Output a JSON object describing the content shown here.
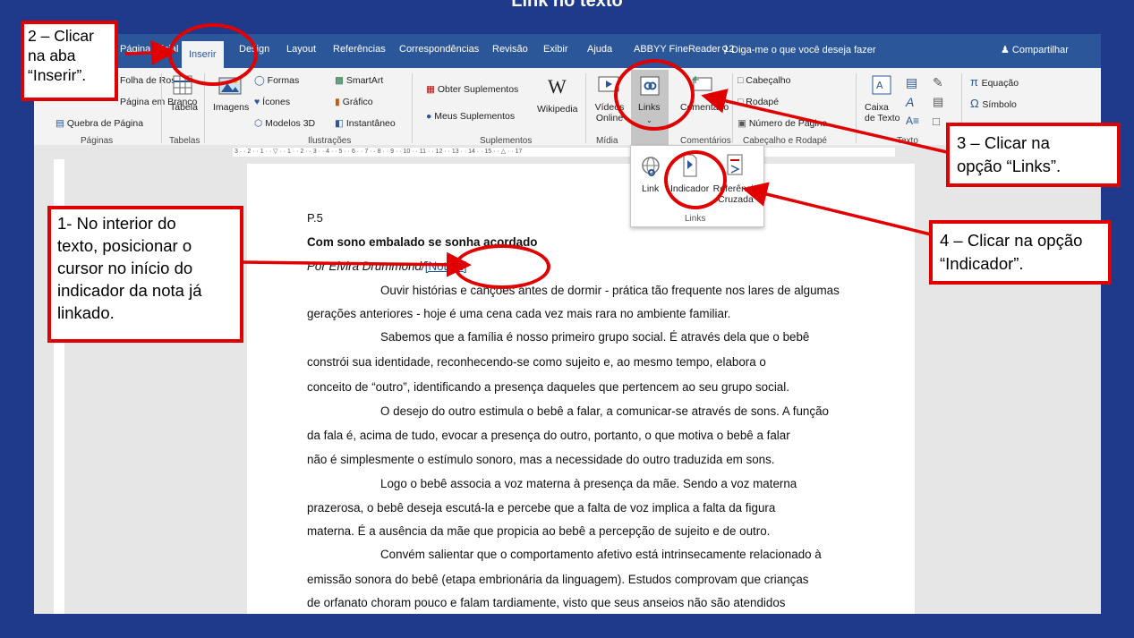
{
  "slide": {
    "title": "Link no texto"
  },
  "tabs": [
    {
      "label": "Página Inicial"
    },
    {
      "label": "Inserir"
    },
    {
      "label": "Design"
    },
    {
      "label": "Layout"
    },
    {
      "label": "Referências"
    },
    {
      "label": "Correspondências"
    },
    {
      "label": "Revisão"
    },
    {
      "label": "Exibir"
    },
    {
      "label": "Ajuda"
    },
    {
      "label": "ABBYY FineReader 12"
    }
  ],
  "tell_me": "Diga-me o que você deseja fazer",
  "share": "Compartilhar",
  "ribbon": {
    "paginas": {
      "capa": "Folha de Rosto",
      "branco": "Página em Branco",
      "quebra": "Quebra de Página",
      "group": "Páginas"
    },
    "tabelas": {
      "tabela": "Tabela",
      "group": "Tabelas"
    },
    "ilustracoes": {
      "imagens": "Imagens",
      "formas": "Formas",
      "icones": "Ícones",
      "modelos": "Modelos 3D",
      "smartart": "SmartArt",
      "grafico": "Gráfico",
      "instantaneo": "Instantâneo",
      "group": "Ilustrações"
    },
    "suplementos": {
      "obter": "Obter Suplementos",
      "meus": "Meus Suplementos",
      "wikipedia": "Wikipedia",
      "group": "Suplementos"
    },
    "midia": {
      "videos": "Vídeos Online",
      "group": "Mídia"
    },
    "links": {
      "label": "Links"
    },
    "comentarios": {
      "comentario": "Comentário",
      "group": "Comentários"
    },
    "cabecalho": {
      "cabecalho": "Cabeçalho",
      "rodape": "Rodapé",
      "numero": "Número de Página",
      "group": "Cabeçalho e Rodapé"
    },
    "texto": {
      "caixa": "Caixa de Texto",
      "group": "Texto"
    },
    "simbolos": {
      "equacao": "Equação",
      "simbolo": "Símbolo"
    }
  },
  "links_menu": {
    "link": "Link",
    "indicador": "Indicador",
    "referencia": "Referência Cruzada",
    "group": "Links"
  },
  "document": {
    "page": "P.5",
    "title": "Com sono embalado se sonha acordado",
    "author": "Por Elvira Drummond/",
    "note": "[Nota 1]",
    "lines": [
      "Ouvir histórias e canções antes de dormir - prática tão frequente nos lares de algumas",
      "gerações anteriores - hoje é uma cena cada vez mais rara no ambiente familiar.",
      "Sabemos que a família é nosso primeiro grupo social. É através dela que o bebê",
      "constrói sua identidade, reconhecendo-se como sujeito e, ao mesmo tempo, elabora o",
      "conceito de “outro”, identificando a presença daqueles que pertencem ao seu grupo social.",
      "O desejo do outro estimula o bebê a falar, a comunicar-se através de sons. A função",
      "da fala é, acima de tudo, evocar a presença do outro, portanto, o que motiva o bebê a falar",
      "não é simplesmente o estímulo sonoro, mas a necessidade do outro traduzida em sons.",
      "Logo o bebê associa a voz materna à presença da mãe. Sendo a voz materna",
      "prazerosa, o bebê deseja escutá-la e percebe que a falta de voz implica a falta da figura",
      "materna. É a ausência da mãe que propicia ao bebê a percepção de sujeito e de outro.",
      "Convém salientar que o comportamento afetivo está intrinsecamente relacionado à",
      "emissão sonora do bebê (etapa embrionária da linguagem). Estudos comprovam que crianças",
      "de orfanato choram pouco e falam tardiamente, visto que seus anseios não são atendidos"
    ]
  },
  "callouts": {
    "step1": [
      "1- No interior do",
      "texto, posicionar o",
      "cursor no início do",
      "indicador da nota já",
      "linkado."
    ],
    "step2": [
      "2 – Clicar",
      "na aba",
      "“Inserir”."
    ],
    "step3": [
      "3 – Clicar na",
      "opção “Links”."
    ],
    "step4": [
      "4 – Clicar na opção",
      "“Indicador”."
    ]
  },
  "colors": {
    "accent_red": "#e00000",
    "word_blue": "#2b579a",
    "slide_bg": "#1f3a8a"
  }
}
